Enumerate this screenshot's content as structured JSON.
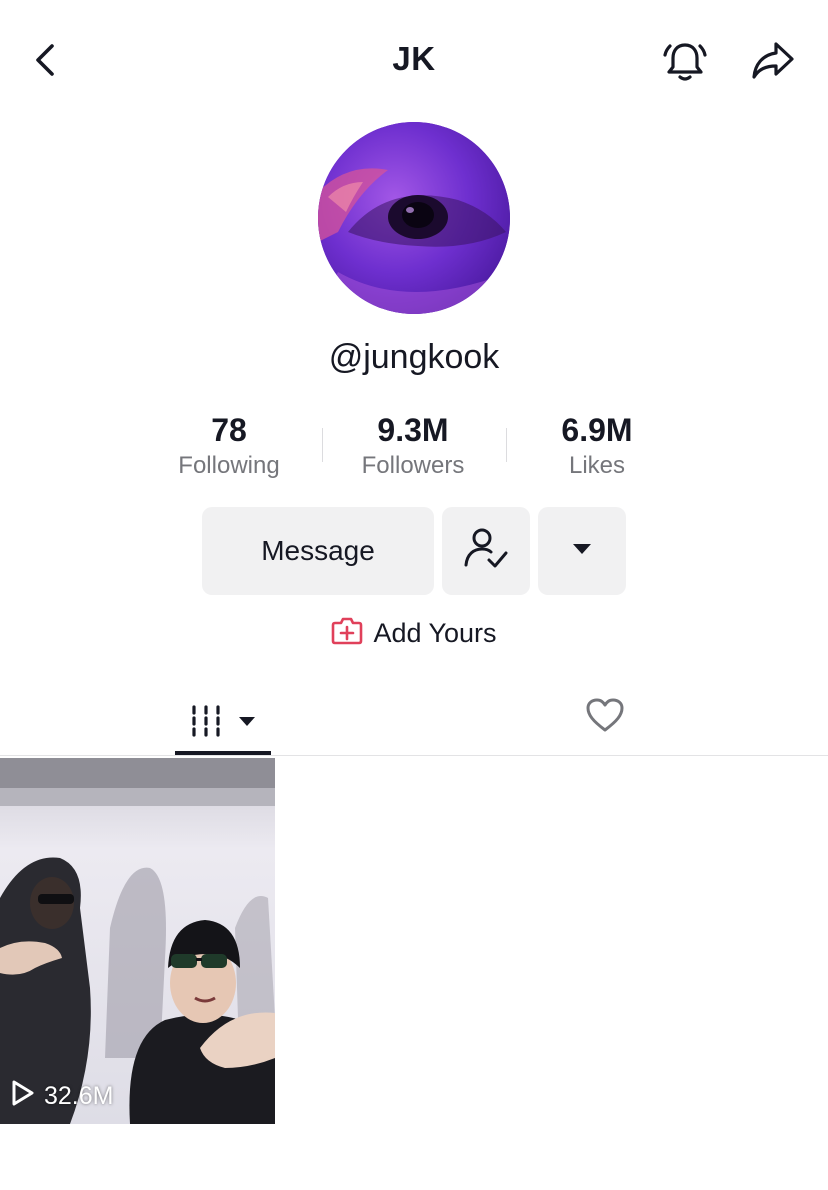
{
  "header": {
    "title": "JK",
    "back_icon": "chevron-left-icon",
    "bell_icon": "bell-icon",
    "share_icon": "share-arrow-icon"
  },
  "profile": {
    "username": "@jungkook",
    "avatar": "purple-eye-avatar"
  },
  "stats": [
    {
      "value": "78",
      "label": "Following"
    },
    {
      "value": "9.3M",
      "label": "Followers"
    },
    {
      "value": "6.9M",
      "label": "Likes"
    }
  ],
  "actions": {
    "message_label": "Message",
    "friends_icon": "user-check-icon",
    "more_icon": "caret-down-icon"
  },
  "add_yours": {
    "label": "Add Yours",
    "icon": "add-camera-icon",
    "icon_color": "#fe2c55"
  },
  "tabs": [
    {
      "name": "videos",
      "icon": "grid-icon",
      "active": true
    },
    {
      "name": "liked",
      "icon": "heart-outline-icon",
      "active": false
    }
  ],
  "videos": [
    {
      "views": "32.6M",
      "icon": "play-outline-icon"
    }
  ],
  "colors": {
    "text": "#161823",
    "muted": "#75767b",
    "button_bg": "#f1f1f2",
    "accent": "#fe2c55"
  }
}
